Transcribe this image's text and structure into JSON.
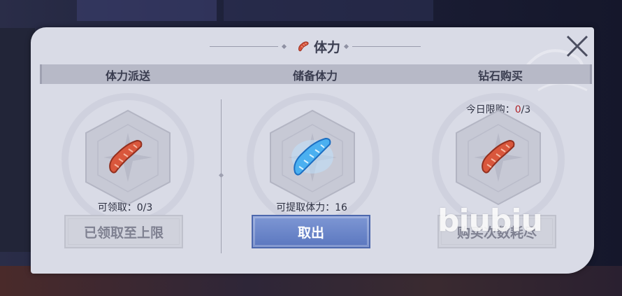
{
  "title": {
    "text": "体力",
    "icon": "sausage-icon"
  },
  "columns": [
    {
      "header": "体力派送",
      "icon": "sausage-icon",
      "info": {
        "label": "可领取：",
        "value": "0/3"
      },
      "button": {
        "label": "已领取至上限",
        "state": "disabled"
      }
    },
    {
      "header": "储备体力",
      "icon": "blue-sausage-icon",
      "info": {
        "label": "可提取体力：",
        "value": "16"
      },
      "button": {
        "label": "取出",
        "state": "active"
      }
    },
    {
      "header": "钻石购买",
      "icon": "sausage-icon",
      "limit": {
        "label": "今日限购：",
        "count": "0",
        "rest": "/3"
      },
      "button": {
        "label": "购买次数耗尽",
        "state": "disabled"
      }
    }
  ],
  "watermark": "biubiu",
  "colors": {
    "primary_button": "#6b86c9",
    "limit_count": "#b0242a",
    "panel": "#d9dbe6"
  }
}
